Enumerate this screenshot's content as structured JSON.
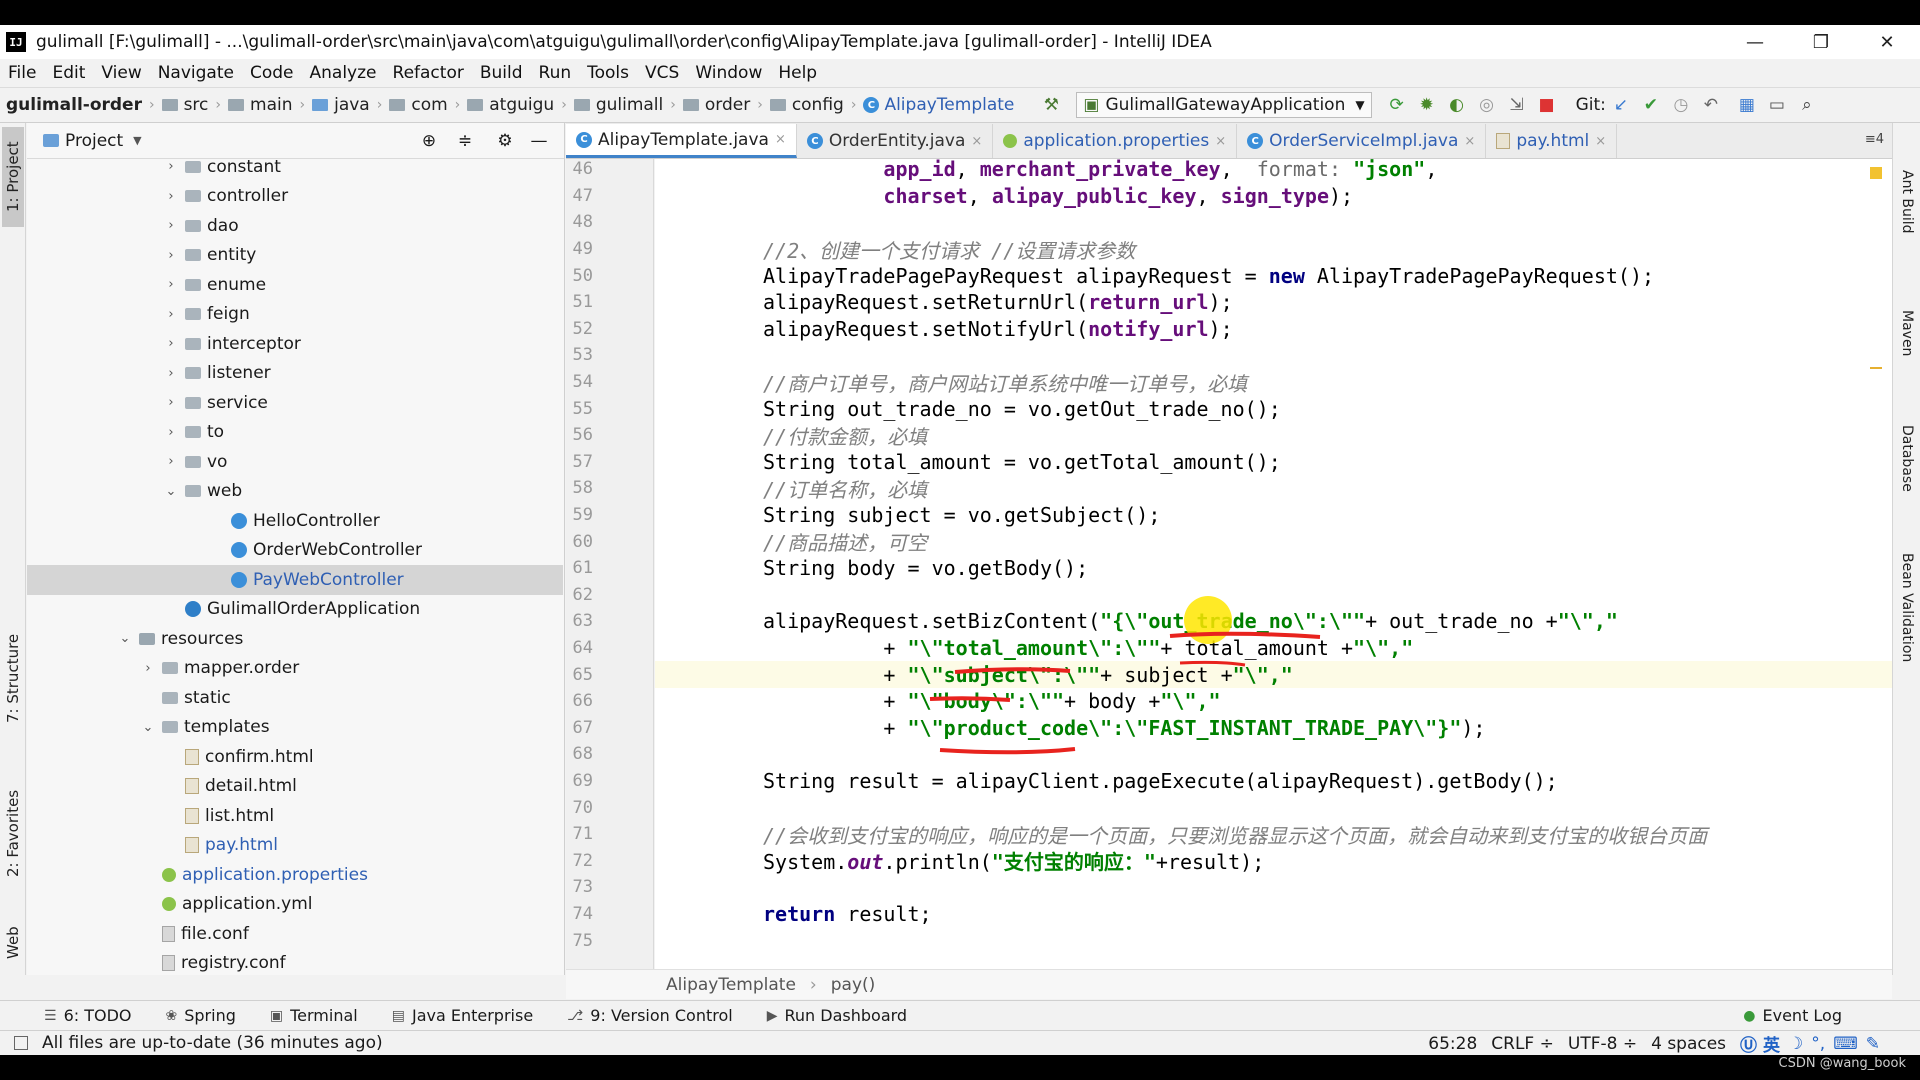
{
  "window": {
    "title": "gulimall [F:\\gulimall] - ...\\gulimall-order\\src\\main\\java\\com\\atguigu\\gulimall\\order\\config\\AlipayTemplate.java [gulimall-order] - IntelliJ IDEA",
    "logo": "IJ",
    "minimize": "—",
    "restore": "❐",
    "close": "✕"
  },
  "menu": [
    "File",
    "Edit",
    "View",
    "Navigate",
    "Code",
    "Analyze",
    "Refactor",
    "Build",
    "Run",
    "Tools",
    "VCS",
    "Window",
    "Help"
  ],
  "navbar": {
    "crumbs": [
      "gulimall-order",
      "src",
      "main",
      "java",
      "com",
      "atguigu",
      "gulimall",
      "order",
      "config",
      "AlipayTemplate"
    ],
    "run_config": "GulimallGatewayApplication",
    "git_label": "Git:"
  },
  "left_tabs": {
    "project": "1: Project",
    "structure": "7: Structure",
    "favorites": "2: Favorites",
    "web": "Web"
  },
  "right_tabs": {
    "ant": "Ant Build",
    "maven": "Maven",
    "database": "Database",
    "bean": "Bean Validation"
  },
  "project_panel": {
    "title": "Project",
    "tree": [
      {
        "label": "constant",
        "arrow": "›",
        "icon": "folder",
        "indent": 1
      },
      {
        "label": "controller",
        "arrow": "›",
        "icon": "folder",
        "indent": 1
      },
      {
        "label": "dao",
        "arrow": "›",
        "icon": "folder",
        "indent": 1
      },
      {
        "label": "entity",
        "arrow": "›",
        "icon": "folder",
        "indent": 1
      },
      {
        "label": "enume",
        "arrow": "›",
        "icon": "folder",
        "indent": 1
      },
      {
        "label": "feign",
        "arrow": "›",
        "icon": "folder",
        "indent": 1
      },
      {
        "label": "interceptor",
        "arrow": "›",
        "icon": "folder",
        "indent": 1
      },
      {
        "label": "listener",
        "arrow": "›",
        "icon": "folder",
        "indent": 1
      },
      {
        "label": "service",
        "arrow": "›",
        "icon": "folder",
        "indent": 1
      },
      {
        "label": "to",
        "arrow": "›",
        "icon": "folder",
        "indent": 1
      },
      {
        "label": "vo",
        "arrow": "›",
        "icon": "folder",
        "indent": 1
      },
      {
        "label": "web",
        "arrow": "⌄",
        "icon": "folder",
        "indent": 1
      },
      {
        "label": "HelloController",
        "arrow": "",
        "icon": "cls",
        "indent": 2
      },
      {
        "label": "OrderWebController",
        "arrow": "",
        "icon": "cls",
        "indent": 2
      },
      {
        "label": "PayWebController",
        "arrow": "",
        "icon": "cls",
        "indent": 2,
        "selected": true
      },
      {
        "label": "GulimallOrderApplication",
        "arrow": "",
        "icon": "appcls",
        "indent": 1
      },
      {
        "label": "resources",
        "arrow": "⌄",
        "icon": "res",
        "indent": 0
      },
      {
        "label": "mapper.order",
        "arrow": "›",
        "icon": "folder",
        "indent": 0.5
      },
      {
        "label": "static",
        "arrow": "",
        "icon": "folder",
        "indent": 0.5
      },
      {
        "label": "templates",
        "arrow": "⌄",
        "icon": "folder",
        "indent": 0.5
      },
      {
        "label": "confirm.html",
        "arrow": "",
        "icon": "html",
        "indent": 1
      },
      {
        "label": "detail.html",
        "arrow": "",
        "icon": "html",
        "indent": 1
      },
      {
        "label": "list.html",
        "arrow": "",
        "icon": "html",
        "indent": 1
      },
      {
        "label": "pay.html",
        "arrow": "",
        "icon": "html",
        "indent": 1,
        "color": "#2f5fb3"
      },
      {
        "label": "application.properties",
        "arrow": "",
        "icon": "props",
        "indent": 0.5,
        "color": "#2f5fb3"
      },
      {
        "label": "application.yml",
        "arrow": "",
        "icon": "props",
        "indent": 0.5
      },
      {
        "label": "file.conf",
        "arrow": "",
        "icon": "file",
        "indent": 0.5
      },
      {
        "label": "registry.conf",
        "arrow": "",
        "icon": "file",
        "indent": 0.5
      }
    ]
  },
  "editor": {
    "tabs": [
      {
        "label": "AlipayTemplate.java",
        "active": true,
        "color": "#222"
      },
      {
        "label": "OrderEntity.java",
        "active": false,
        "color": "#333"
      },
      {
        "label": "application.properties",
        "active": false,
        "color": "#2f5fb3"
      },
      {
        "label": "OrderServiceImpl.java",
        "active": false,
        "color": "#2f5fb3"
      },
      {
        "label": "pay.html",
        "active": false,
        "color": "#2f5fb3"
      }
    ],
    "tab_count": "≡4",
    "lines": [
      {
        "n": "46",
        "html": "          <span class=\"fld\">app_id</span>, <span class=\"fld\">merchant_private_key</span>,  <span class=\"hint\">format:</span> <span class=\"str\">\"json\"</span>,"
      },
      {
        "n": "47",
        "html": "          <span class=\"fld\">charset</span>, <span class=\"fld\">alipay_public_key</span>, <span class=\"fld\">sign_type</span>);"
      },
      {
        "n": "48",
        "html": ""
      },
      {
        "n": "49",
        "html": "<span class=\"cmt\">//2、创建一个支付请求 //设置请求参数</span>"
      },
      {
        "n": "50",
        "html": "AlipayTradePagePayRequest alipayRequest = <span class=\"kw\">new</span> AlipayTradePagePayRequest();"
      },
      {
        "n": "51",
        "html": "alipayRequest.setReturnUrl(<span class=\"fld\">return_url</span>);"
      },
      {
        "n": "52",
        "html": "alipayRequest.setNotifyUrl(<span class=\"fld\">notify_url</span>);"
      },
      {
        "n": "53",
        "html": ""
      },
      {
        "n": "54",
        "html": "<span class=\"cmt\">//商户订单号，商户网站订单系统中唯一订单号，必填</span>"
      },
      {
        "n": "55",
        "html": "String out_trade_no = vo.getOut_trade_no();"
      },
      {
        "n": "56",
        "html": "<span class=\"cmt\">//付款金额，必填</span>"
      },
      {
        "n": "57",
        "html": "String total_amount = vo.getTotal_amount();"
      },
      {
        "n": "58",
        "html": "<span class=\"cmt\">//订单名称，必填</span>"
      },
      {
        "n": "59",
        "html": "String subject = vo.getSubject();"
      },
      {
        "n": "60",
        "html": "<span class=\"cmt\">//商品描述，可空</span>"
      },
      {
        "n": "61",
        "html": "String body = vo.getBody();"
      },
      {
        "n": "62",
        "html": ""
      },
      {
        "n": "63",
        "html": "alipayRequest.setBizContent(<span class=\"str\">\"{\\\"out_trade_no\\\":\\\"\"</span>+ out_trade_no +<span class=\"str\">\"\\\",\"</span>"
      },
      {
        "n": "64",
        "html": "          + <span class=\"str\">\"\\\"total_amount\\\":\\\"\"</span>+ total_amount +<span class=\"str\">\"\\\",\"</span>"
      },
      {
        "n": "65",
        "html": "          + <span class=\"str\">\"\\\"subject\\\":\\\"\"</span>+ subject +<span class=\"str\">\"\\\",\"</span>",
        "current": true
      },
      {
        "n": "66",
        "html": "          + <span class=\"str\">\"\\\"body\\\":\\\"\"</span>+ body +<span class=\"str\">\"\\\",\"</span>"
      },
      {
        "n": "67",
        "html": "          + <span class=\"str\">\"\\\"product_code\\\":\\\"FAST_INSTANT_TRADE_PAY\\\"}\"</span>);"
      },
      {
        "n": "68",
        "html": ""
      },
      {
        "n": "69",
        "html": "String result = alipayClient.pageExecute(alipayRequest).getBody();"
      },
      {
        "n": "70",
        "html": ""
      },
      {
        "n": "71",
        "html": "<span class=\"cmt\">//会收到支付宝的响应，响应的是一个页面，只要浏览器显示这个页面，就会自动来到支付宝的收银台页面</span>"
      },
      {
        "n": "72",
        "html": "System.<span class=\"fld\" style=\"font-style:italic\">out</span>.println(<span class=\"str\">\"支付宝的响应：\"</span>+result);"
      },
      {
        "n": "73",
        "html": ""
      },
      {
        "n": "74",
        "html": "<span class=\"kw\">return</span> result;"
      },
      {
        "n": "75",
        "html": ""
      }
    ],
    "crumb_class": "AlipayTemplate",
    "crumb_method": "pay()"
  },
  "bottom_tabs": [
    {
      "icon": "☰",
      "label": "6: TODO"
    },
    {
      "icon": "❀",
      "label": "Spring"
    },
    {
      "icon": "▣",
      "label": "Terminal"
    },
    {
      "icon": "▤",
      "label": "Java Enterprise"
    },
    {
      "icon": "⎇",
      "label": "9: Version Control"
    },
    {
      "icon": "▶",
      "label": "Run Dashboard"
    }
  ],
  "event_log": "Event Log",
  "status": {
    "message": "All files are up-to-date (36 minutes ago)",
    "position": "65:28",
    "line_sep": "CRLF ÷",
    "encoding": "UTF-8 ÷",
    "indent": "4 spaces",
    "ime": "英"
  },
  "watermark": "CSDN @wang_book",
  "colors": {
    "accent": "#4083c9",
    "annotation_red": "#e8231e",
    "cursor_highlight": "#ffe600"
  }
}
